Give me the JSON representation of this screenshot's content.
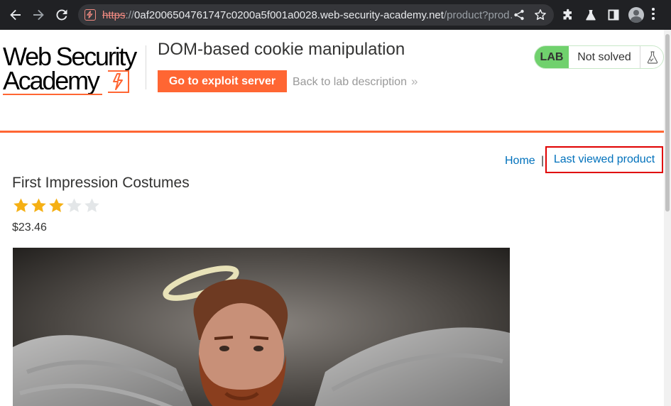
{
  "browser": {
    "url_scheme": "https",
    "url_sep": "://",
    "url_host": "0af2006504761747c0200a5f001a0028.web-security-academy.net",
    "url_path": "/product?prod…",
    "colors": {
      "frame": "#202124",
      "omnibox": "#35363a",
      "insecure": "#f28b82"
    }
  },
  "header": {
    "logo_line1": "Web Security",
    "logo_line2": "Academy",
    "lab_title": "DOM-based cookie manipulation",
    "exploit_button": "Go to exploit server",
    "back_link": "Back to lab description",
    "back_chevron": "»",
    "lab_badge": "LAB",
    "lab_status": "Not solved",
    "colors": {
      "brand": "#ff6633",
      "lab_green": "#70d16d"
    }
  },
  "topnav": {
    "home": "Home",
    "pipe": "|",
    "last_viewed": "Last viewed product",
    "colors": {
      "link": "#0071bc",
      "highlight": "#e00000"
    }
  },
  "product": {
    "name": "First Impression Costumes",
    "rating": 3,
    "rating_max": 5,
    "price": "$23.46",
    "image_icon": "angel-costume-photo"
  }
}
